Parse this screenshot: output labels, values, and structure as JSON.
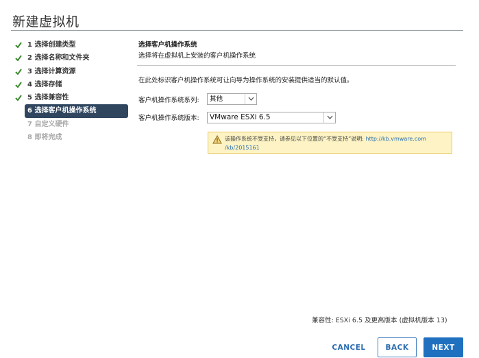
{
  "dialog": {
    "title": "新建虚拟机"
  },
  "steps": [
    {
      "label": "1 选择创建类型",
      "state": "done"
    },
    {
      "label": "2 选择名称和文件夹",
      "state": "done"
    },
    {
      "label": "3 选择计算资源",
      "state": "done"
    },
    {
      "label": "4 选择存储",
      "state": "done"
    },
    {
      "label": "5 选择兼容性",
      "state": "done"
    },
    {
      "label": "6 选择客户机操作系统",
      "state": "active"
    },
    {
      "label": "7 自定义硬件",
      "state": "disabled"
    },
    {
      "label": "8 即将完成",
      "state": "disabled"
    }
  ],
  "content": {
    "header_title": "选择客户机操作系统",
    "header_subtitle": "选择将在虚拟机上安装的客户机操作系统",
    "intro": "在此处标识客户机操作系统可让向导为操作系统的安装提供适当的默认值。",
    "family_label": "客户机操作系统系列:",
    "family_value": "其他",
    "version_label": "客户机操作系统版本:",
    "version_value": "VMware ESXi 6.5",
    "warning_text": "该操作系统不受支持，请参见以下位置的“不受支持”说明:",
    "warning_link_1": "http://kb.vmware.com",
    "warning_link_2": "/kb/2015161"
  },
  "footer": {
    "compat": "兼容性: ESXi 6.5 及更高版本 (虚拟机版本 13)",
    "cancel_label": "CANCEL",
    "back_label": "BACK",
    "next_label": "NEXT"
  },
  "colors": {
    "accent": "#1f70bf",
    "active_step_bg": "#30465f",
    "check_green": "#3c8a2e",
    "warning_bg": "#fdf3c4"
  },
  "icons": {
    "step_done": "check-icon",
    "warning": "warning-icon",
    "dropdown": "chevron-down-icon"
  }
}
